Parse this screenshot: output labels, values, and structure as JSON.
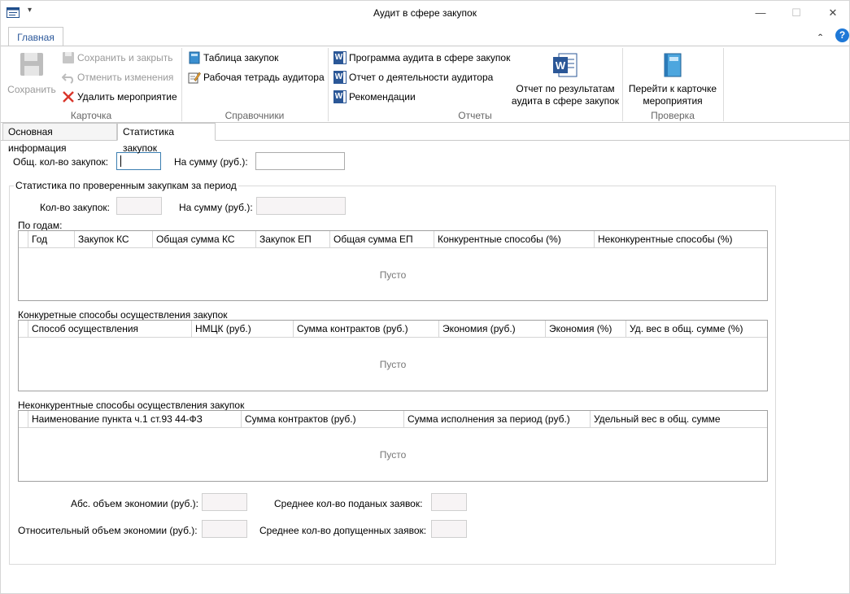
{
  "window": {
    "title": "Аудит в сфере закупок",
    "menu_glyph": "▾",
    "minimize_glyph": "—",
    "maximize_glyph": "☐",
    "close_glyph": "✕"
  },
  "ribbon": {
    "tab_label": "Главная",
    "collapse_glyph": "ˆ",
    "help_glyph": "?",
    "groups": {
      "card": {
        "label": "Карточка",
        "save": "Сохранить",
        "save_close": "Сохранить и закрыть",
        "cancel_changes": "Отменить изменения",
        "delete_event": "Удалить мероприятие"
      },
      "refs": {
        "label": "Справочники",
        "purchases_table": "Таблица закупок",
        "auditor_workbook": "Рабочая тетрадь аудитора"
      },
      "reports": {
        "label": "Отчеты",
        "audit_program": "Программа аудита в сфере закупок",
        "auditor_report": "Отчет о деятельности аудитора",
        "recommendations": "Рекомендации",
        "results_report_line1": "Отчет по результатам",
        "results_report_line2": "аудита в сфере закупок"
      },
      "check": {
        "label": "Проверка",
        "goto_line1": "Перейти к карточке",
        "goto_line2": "мероприятия"
      }
    }
  },
  "tabs": [
    {
      "label": "Основная информация",
      "active": false
    },
    {
      "label": "Статистика закупок",
      "active": true
    }
  ],
  "form": {
    "total_count_label": "Общ. кол-во закупок:",
    "total_count_value": "",
    "total_sum_label": "На сумму (руб.):",
    "total_sum_value": "",
    "period_group_title": "Статистика по проверенным закупкам за период",
    "count_label": "Кол-во закупок:",
    "count_value": "",
    "sum_label": "На сумму (руб.):",
    "sum_value": "",
    "by_years_label": "По годам:",
    "by_years_columns": [
      "Год",
      "Закупок КС",
      "Общая сумма КС",
      "Закупок ЕП",
      "Общая сумма ЕП",
      "Конкурентные способы (%)",
      "Неконкурентные способы (%)"
    ],
    "empty_text": "Пусто",
    "competitive_label": "Конкуретные способы осуществления закупок",
    "competitive_columns": [
      "Способ осуществления",
      "НМЦК (руб.)",
      "Сумма контрактов (руб.)",
      "Экономия (руб.)",
      "Экономия (%)",
      "Уд. вес в общ. сумме (%)"
    ],
    "noncompetitive_label": "Неконкурентные способы осуществления закупок",
    "noncompetitive_columns": [
      "Наименование пункта ч.1 ст.93 44-ФЗ",
      "Сумма контрактов (руб.)",
      "Сумма исполнения за период (руб.)",
      "Удельный вес в общ. сумме"
    ],
    "abs_savings_label": "Абс. объем экономии (руб.):",
    "abs_savings_value": "",
    "rel_savings_label": "Относительный объем экономии (руб.):",
    "rel_savings_value": "",
    "avg_submitted_label": "Среднее кол-во поданых заявок:",
    "avg_submitted_value": "",
    "avg_admitted_label": "Среднее кол-во допущенных заявок:",
    "avg_admitted_value": ""
  },
  "colors": {
    "accent": "#2a579a",
    "word_blue": "#2b5797",
    "help_blue": "#1e78d7",
    "delete_red": "#d9352a"
  }
}
